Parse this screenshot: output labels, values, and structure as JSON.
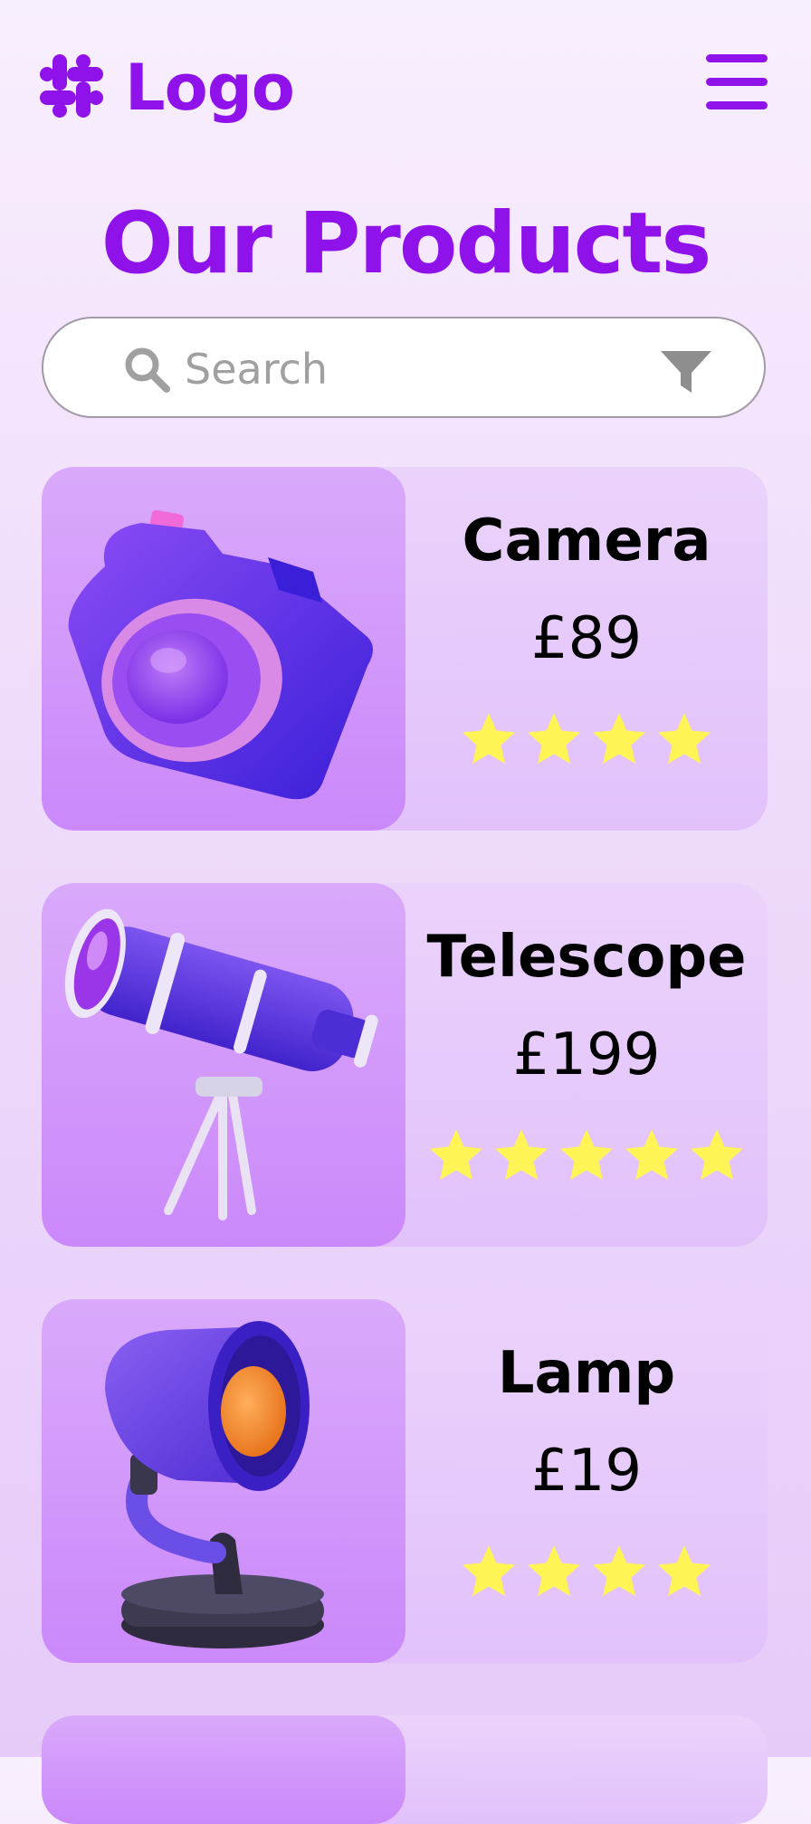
{
  "header": {
    "logo_text": "Logo",
    "logo_icon": "slack-hash-icon",
    "menu_icon": "hamburger-menu-icon"
  },
  "page": {
    "title": "Our Products"
  },
  "search": {
    "placeholder": "Search",
    "value": "",
    "filter_icon": "filter-funnel-icon"
  },
  "colors": {
    "brand": "#8f12ea",
    "star": "#fff455",
    "card_bg": "#e6c9fb",
    "image_bg": "#d29bfa"
  },
  "products": [
    {
      "name": "Camera",
      "price": "£89",
      "rating": 4,
      "image_icon": "camera-icon"
    },
    {
      "name": "Telescope",
      "price": "£199",
      "rating": 5,
      "image_icon": "telescope-icon"
    },
    {
      "name": "Lamp",
      "price": "£19",
      "rating": 4,
      "image_icon": "desk-lamp-icon"
    }
  ]
}
